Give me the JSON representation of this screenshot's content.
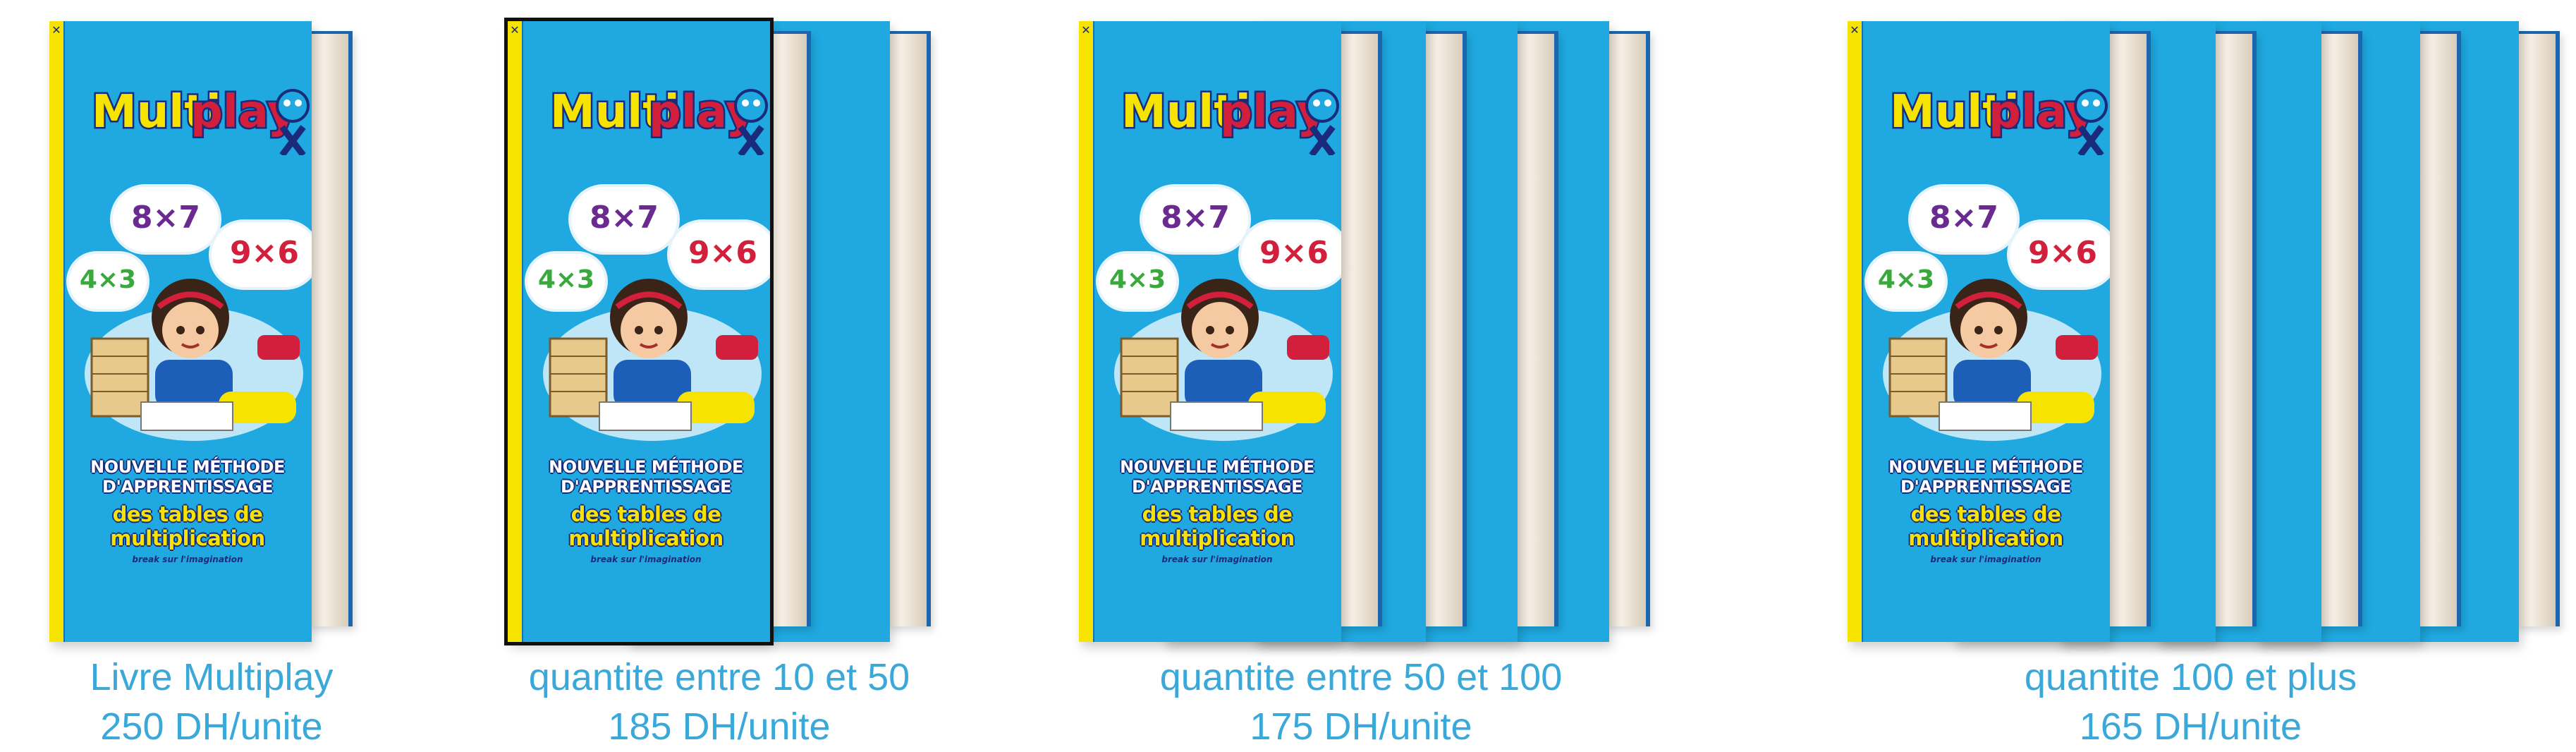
{
  "book": {
    "logo_text_a": "Multi",
    "logo_text_b": "play",
    "ops": [
      "8×7",
      "9×6",
      "4×3"
    ],
    "title_line1": "NOUVELLE MÉTHODE D'APPRENTISSAGE",
    "title_line2": "des tables de multiplication",
    "tagline": "break sur l'imagination"
  },
  "offers": [
    {
      "line1": "Livre Multiplay",
      "line2": "250 DH/unite"
    },
    {
      "line1": "quantite entre 10 et 50",
      "line2": "185 DH/unite"
    },
    {
      "line1": "quantite entre 50 et 100",
      "line2": "175 DH/unite"
    },
    {
      "line1": "quantite 100 et plus",
      "line2": "165 DH/unite"
    }
  ],
  "colors": {
    "cover": "#1fa9e0",
    "spine": "#f6e400",
    "caption": "#3aa8d8",
    "title_outline": "#1a2b7c"
  }
}
